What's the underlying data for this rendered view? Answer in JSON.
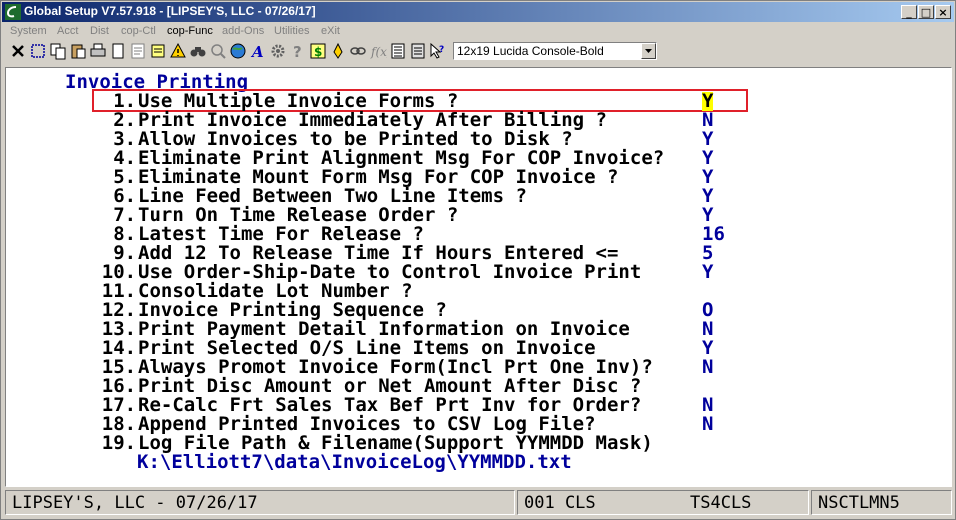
{
  "window": {
    "title": "Global Setup V7.57.918 - [LIPSEY'S, LLC - 07/26/17]"
  },
  "menu": [
    "System",
    "Acct",
    "Dist",
    "cop-Ctl",
    "cop-Func",
    "add-Ons",
    "Utilities",
    "eXit"
  ],
  "toolbar": {
    "icons": [
      "close-x-icon",
      "select-box-icon",
      "copy-icon",
      "paste-icon",
      "print-icon",
      "page-icon",
      "note-icon",
      "edit-icon",
      "alert-icon",
      "binoculars-icon",
      "magnifier-icon",
      "globe-icon",
      "font-a-icon",
      "gear-icon",
      "question-icon",
      "dollar-icon",
      "link-icon",
      "function-icon",
      "list-icon",
      "help-cursor-icon"
    ],
    "font_value": "12x19 Lucida Console-Bold"
  },
  "screen": {
    "heading": "Invoice Printing",
    "items": [
      {
        "num": "1.",
        "label": "Use Multiple Invoice Forms ?",
        "value": "Y"
      },
      {
        "num": "2.",
        "label": "Print Invoice Immediately After Billing ?",
        "value": "N"
      },
      {
        "num": "3.",
        "label": "Allow Invoices to be Printed to Disk ?",
        "value": "Y"
      },
      {
        "num": "4.",
        "label": "Eliminate Print Alignment Msg For COP Invoice?",
        "value": "Y"
      },
      {
        "num": "5.",
        "label": "Eliminate Mount Form Msg For COP Invoice ?",
        "value": "Y"
      },
      {
        "num": "6.",
        "label": "Line Feed Between Two Line Items ?",
        "value": "Y"
      },
      {
        "num": "7.",
        "label": "Turn On Time Release Order ?",
        "value": "Y"
      },
      {
        "num": "8.",
        "label": "Latest Time For Release ?",
        "value": "16"
      },
      {
        "num": "9.",
        "label": "Add 12 To Release Time If Hours Entered <=",
        "value": "5"
      },
      {
        "num": "10.",
        "label": "Use Order-Ship-Date to Control Invoice Print",
        "value": "Y"
      },
      {
        "num": "11.",
        "label": "Consolidate Lot Number ?",
        "value": ""
      },
      {
        "num": "12.",
        "label": "Invoice Printing Sequence ?",
        "value": "O"
      },
      {
        "num": "13.",
        "label": "Print Payment Detail Information on Invoice",
        "value": "N"
      },
      {
        "num": "14.",
        "label": "Print Selected O/S Line Items on Invoice",
        "value": "Y"
      },
      {
        "num": "15.",
        "label": "Always Promot Invoice Form(Incl Prt One Inv)?",
        "value": "N"
      },
      {
        "num": "16.",
        "label": "Print Disc Amount or Net Amount After Disc ?",
        "value": ""
      },
      {
        "num": "17.",
        "label": "Re-Calc Frt Sales Tax Bef Prt Inv for Order?",
        "value": "N"
      },
      {
        "num": "18.",
        "label": "Append Printed Invoices to CSV Log File?",
        "value": "N"
      },
      {
        "num": "19.",
        "label": "Log File Path & Filename(Support YYMMDD Mask)",
        "value": ""
      }
    ],
    "log_path": "K:\\Elliott7\\data\\InvoiceLog\\YYMMDD.txt"
  },
  "status": {
    "company": "LIPSEY'S, LLC - 07/26/17",
    "code": "001 CLS",
    "terminal": "TS4CLS",
    "user": "NSCTLMN5"
  }
}
